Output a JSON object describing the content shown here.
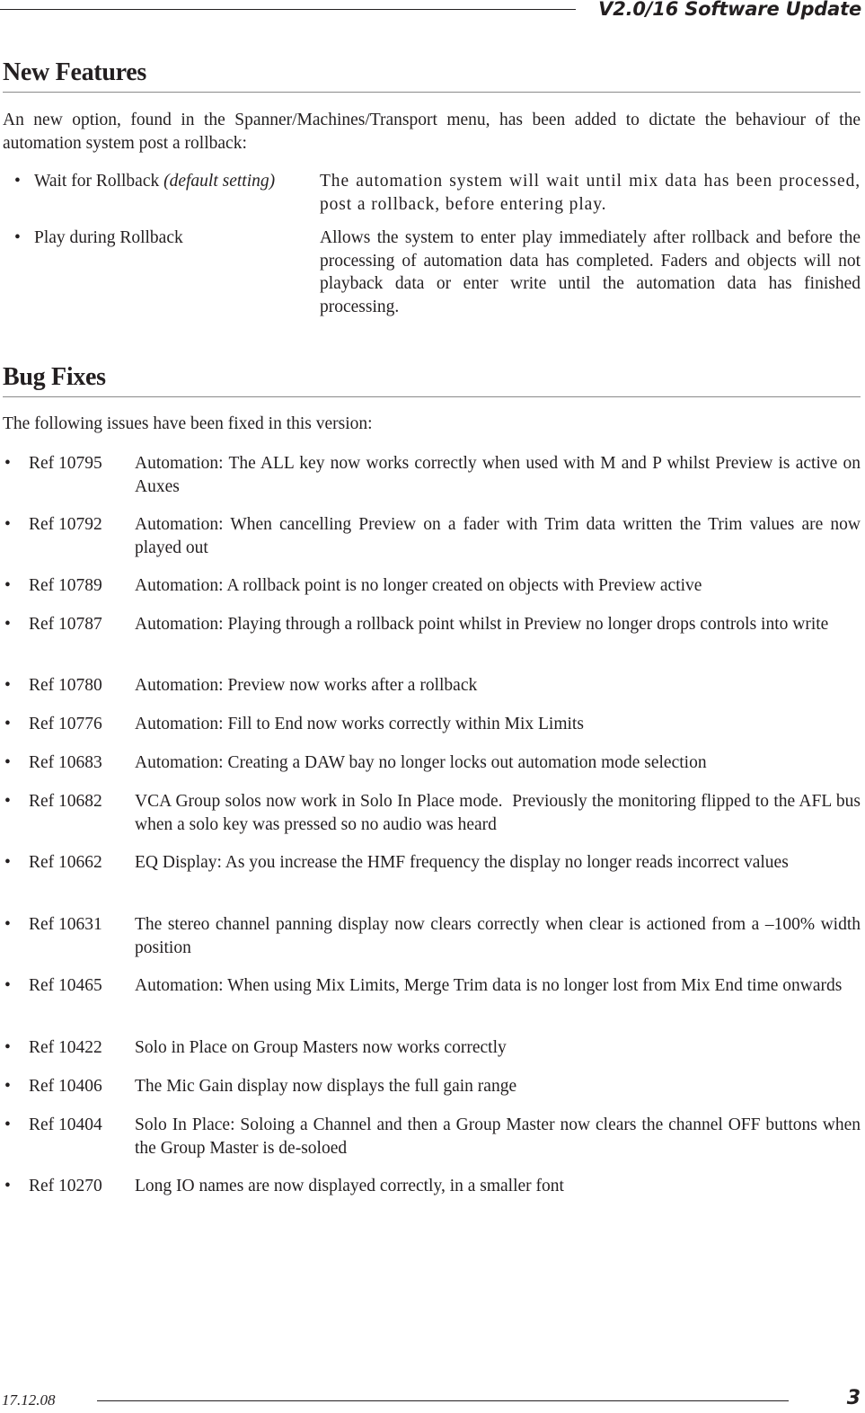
{
  "header": {
    "title": "V2.0/16 Software Update"
  },
  "new_features": {
    "heading": "New Features",
    "intro": "An new option, found in the Spanner/Machines/Transport menu, has been added to dictate the behaviour of the automation system post a rollback:",
    "options": [
      {
        "label": "Wait for Rollback",
        "note": "(default setting)",
        "description": "The automation system will wait until mix data has been processed, post a rollback, before entering play."
      },
      {
        "label": "Play during Rollback",
        "note": "",
        "description": "Allows the system to enter play immediately after rollback and before the processing of automation data has completed. Faders and objects will not playback data or enter write until the automation data has finished processing."
      }
    ]
  },
  "bug_fixes": {
    "heading": "Bug Fixes",
    "intro": "The following issues have been fixed in this version:",
    "items": [
      {
        "ref": "Ref 10795",
        "description": "Automation: The ALL key now works correctly when used with M and P whilst Preview is active on Auxes"
      },
      {
        "ref": "Ref 10792",
        "description": "Automation: When cancelling Preview on a fader with Trim data written the Trim values are now played out"
      },
      {
        "ref": "Ref 10789",
        "description": "Automation: A rollback point is no longer created on objects with Preview active"
      },
      {
        "ref": "Ref 10787",
        "description": "Automation: Playing through a rollback point whilst in Preview no longer drops controls into write"
      },
      {
        "ref": "Ref 10780",
        "description": "Automation: Preview now works after a rollback"
      },
      {
        "ref": "Ref 10776",
        "description": "Automation: Fill to End now works correctly within Mix Limits"
      },
      {
        "ref": "Ref 10683",
        "description": "Automation: Creating a DAW bay no longer locks out automation mode selection"
      },
      {
        "ref": "Ref 10682",
        "description": "VCA Group solos now work in Solo In Place mode.  Previously the monitoring flipped to the AFL bus when a solo key was pressed so no audio was heard"
      },
      {
        "ref": "Ref 10662",
        "description": "EQ Display: As you increase the HMF frequency the display no longer reads incorrect values"
      },
      {
        "ref": "Ref 10631",
        "description": "The stereo channel panning display now clears correctly when clear is actioned from a –100% width position"
      },
      {
        "ref": "Ref 10465",
        "description": "Automation: When using Mix Limits, Merge Trim data is no longer lost from Mix End time onwards"
      },
      {
        "ref": "Ref 10422",
        "description": "Solo in Place on Group Masters now works correctly"
      },
      {
        "ref": "Ref 10406",
        "description": "The Mic Gain display now displays the full gain range"
      },
      {
        "ref": "Ref 10404",
        "description": "Solo In Place: Soloing a Channel and then a Group Master now clears the channel OFF buttons when the Group Master is de-soloed"
      },
      {
        "ref": "Ref 10270",
        "description": "Long IO names are now displayed correctly, in a smaller font"
      }
    ]
  },
  "footer": {
    "date": "17.12.08",
    "page_number": "3"
  },
  "glyphs": {
    "bullet": "•"
  }
}
